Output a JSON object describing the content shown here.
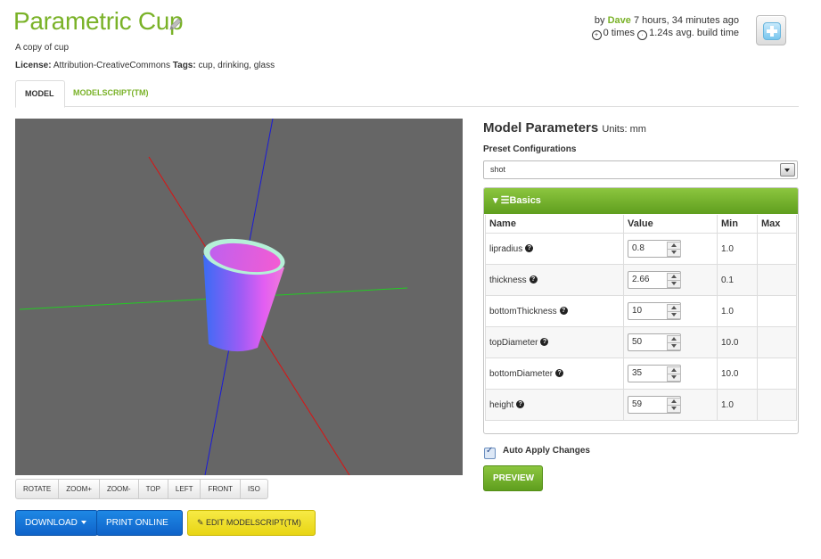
{
  "header": {
    "title": "Parametric Cup",
    "subtitle": "A copy of cup",
    "license_label": "License:",
    "license_value": "Attribution-CreativeCommons",
    "tags_label": "Tags:",
    "tags_value": "cup, drinking, glass",
    "by_prefix": "by",
    "author": "Dave",
    "time_ago": "7 hours, 34 minutes ago",
    "times_count": "0 times",
    "build_time": "1.24s avg. build time",
    "icons": {
      "edit": "pencil-icon",
      "add": "add-plus-icon"
    }
  },
  "tabs": [
    {
      "label": "MODEL",
      "active": true
    },
    {
      "label": "MODELSCRIPT(TM)",
      "active": false
    }
  ],
  "viewer": {
    "background": "#666666",
    "buttons": [
      "ROTATE",
      "ZOOM+",
      "ZOOM-",
      "TOP",
      "LEFT",
      "FRONT",
      "ISO"
    ]
  },
  "actions": {
    "download": "DOWNLOAD",
    "print": "PRINT ONLINE",
    "edit_script": "EDIT MODELSCRIPT(TM)"
  },
  "params": {
    "title": "Model Parameters",
    "units": "Units: mm",
    "preset_label": "Preset Configurations",
    "preset_value": "shot",
    "group_title": "Basics",
    "columns": [
      "Name",
      "Value",
      "Min",
      "Max"
    ],
    "rows": [
      {
        "name": "lipradius",
        "value": "0.8",
        "min": "1.0",
        "max": ""
      },
      {
        "name": "thickness",
        "value": "2.66",
        "min": "0.1",
        "max": ""
      },
      {
        "name": "bottomThickness",
        "value": "10",
        "min": "1.0",
        "max": ""
      },
      {
        "name": "topDiameter",
        "value": "50",
        "min": "10.0",
        "max": ""
      },
      {
        "name": "bottomDiameter",
        "value": "35",
        "min": "10.0",
        "max": ""
      },
      {
        "name": "height",
        "value": "59",
        "min": "1.0",
        "max": ""
      }
    ],
    "auto_apply_label": "Auto Apply Changes",
    "auto_apply_checked": true,
    "preview_label": "PREVIEW"
  },
  "colors": {
    "brand_green": "#7ab228",
    "primary_blue": "#1e88e5",
    "edit_yellow": "#f7ea45"
  }
}
